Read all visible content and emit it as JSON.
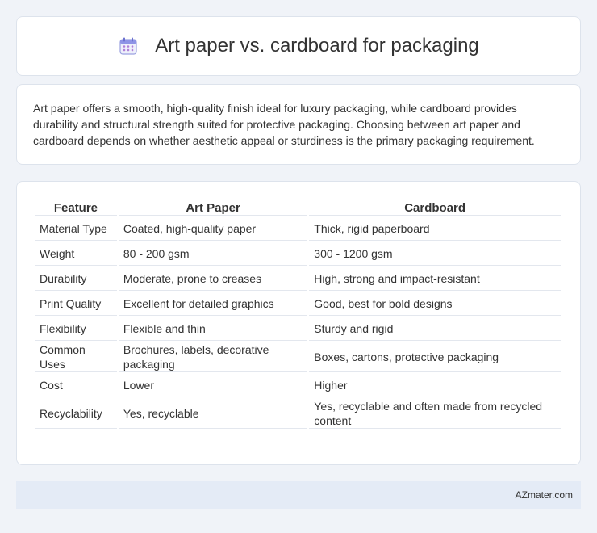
{
  "header": {
    "title": "Art paper vs. cardboard for packaging",
    "icon": "calendar-icon"
  },
  "intro": {
    "text": "Art paper offers a smooth, high-quality finish ideal for luxury packaging, while cardboard provides durability and structural strength suited for protective packaging. Choosing between art paper and cardboard depends on whether aesthetic appeal or sturdiness is the primary packaging requirement."
  },
  "table": {
    "headers": [
      "Feature",
      "Art Paper",
      "Cardboard"
    ],
    "rows": [
      [
        "Material Type",
        "Coated, high-quality paper",
        "Thick, rigid paperboard"
      ],
      [
        "Weight",
        "80 - 200 gsm",
        "300 - 1200 gsm"
      ],
      [
        "Durability",
        "Moderate, prone to creases",
        "High, strong and impact-resistant"
      ],
      [
        "Print Quality",
        "Excellent for detailed graphics",
        "Good, best for bold designs"
      ],
      [
        "Flexibility",
        "Flexible and thin",
        "Sturdy and rigid"
      ],
      [
        "Common Uses",
        "Brochures, labels, decorative packaging",
        "Boxes, cartons, protective packaging"
      ],
      [
        "Cost",
        "Lower",
        "Higher"
      ],
      [
        "Recyclability",
        "Yes, recyclable",
        "Yes, recyclable and often made from recycled content"
      ]
    ]
  },
  "footer": {
    "brand": "AZmater.com"
  },
  "colors": {
    "background": "#f0f3f8",
    "card": "#ffffff",
    "footer": "#e4ebf6",
    "icon_accent": "#7b7fd8"
  }
}
